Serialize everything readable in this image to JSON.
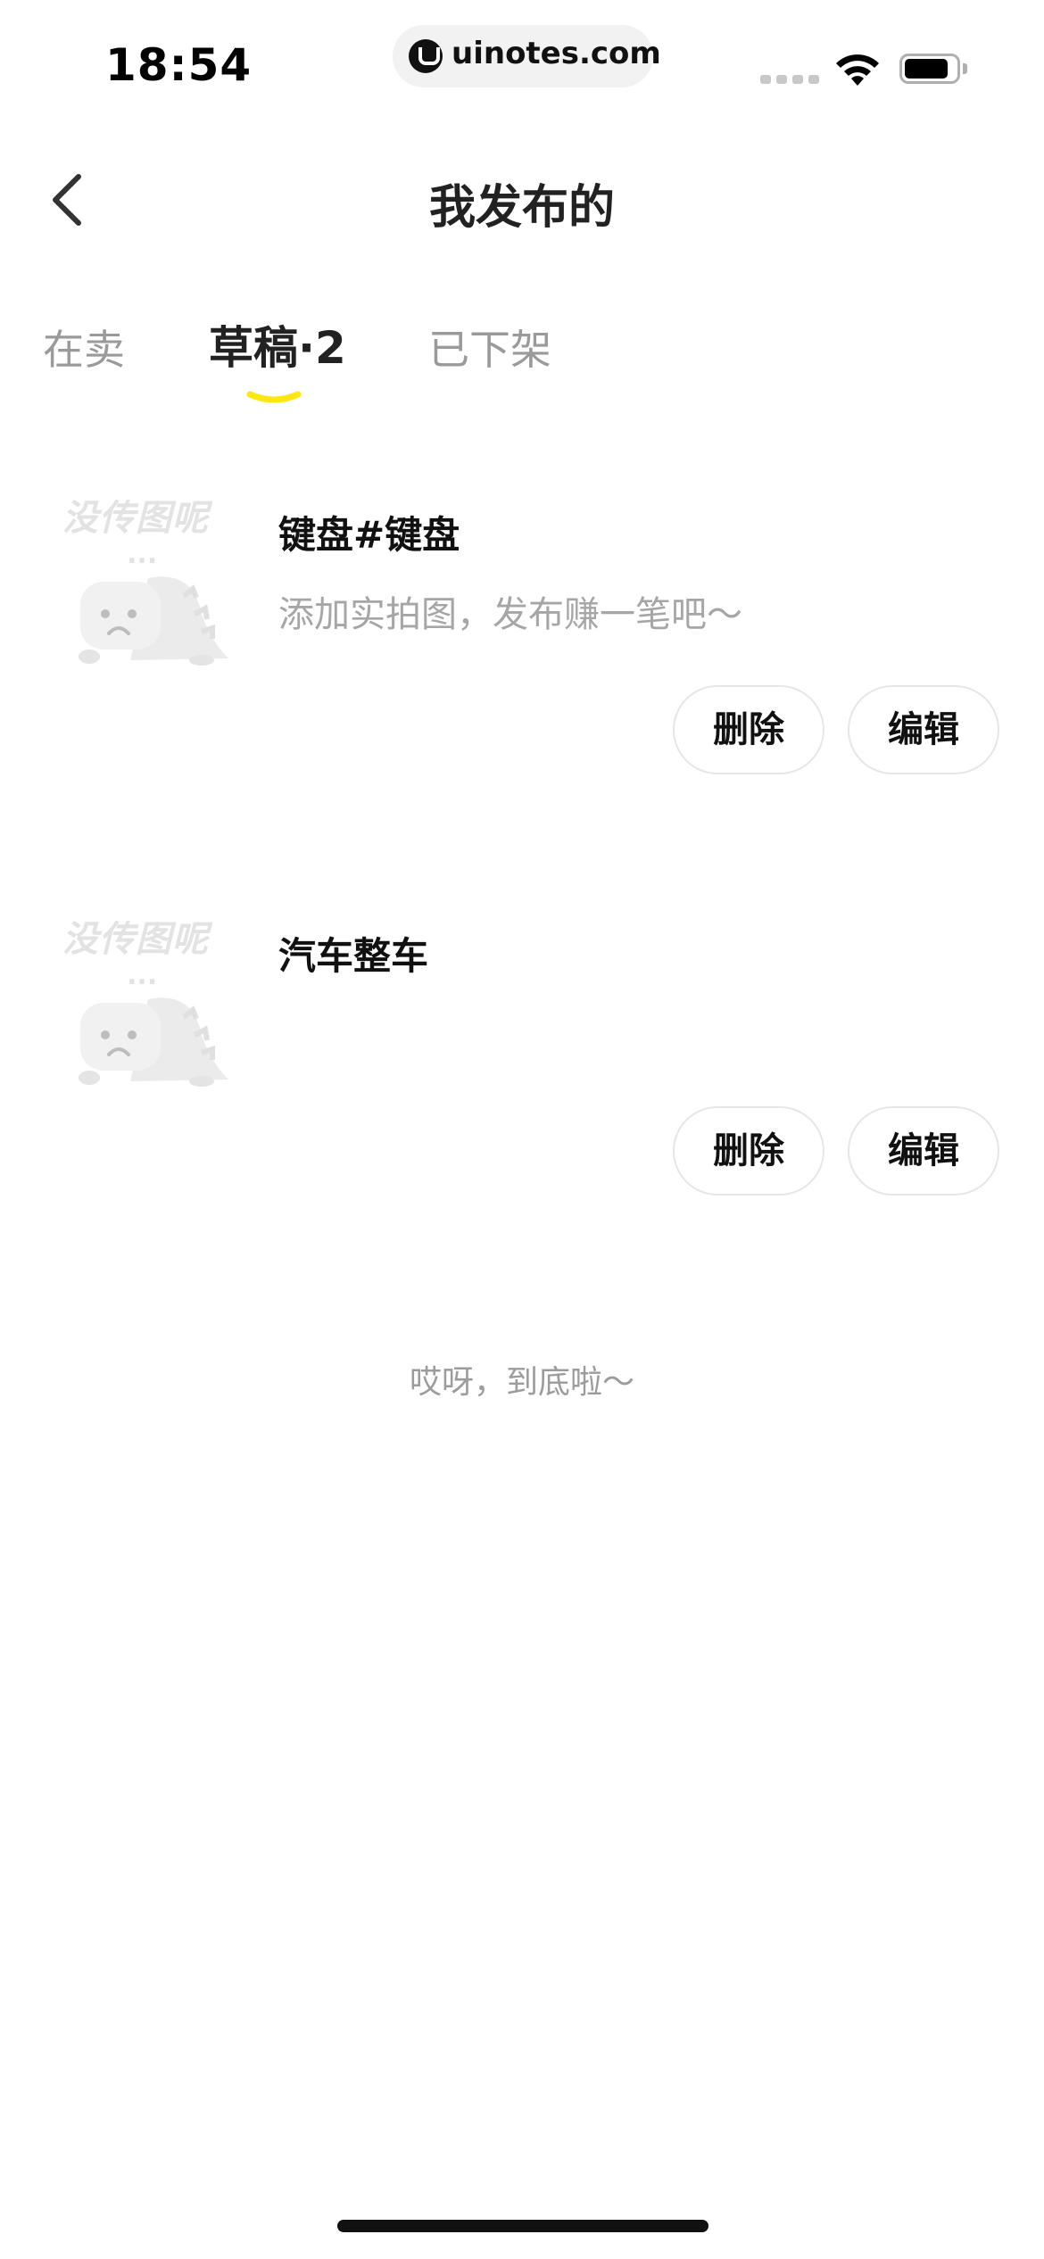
{
  "status_bar": {
    "time": "18:54",
    "url": "uinotes.com"
  },
  "header": {
    "title": "我发布的"
  },
  "tabs": [
    {
      "label": "在卖",
      "active": false
    },
    {
      "label": "草稿·2",
      "active": true
    },
    {
      "label": "已下架",
      "active": false
    }
  ],
  "drafts": [
    {
      "title": "键盘#键盘",
      "subtitle": "添加实拍图，发布赚一笔吧～",
      "placeholder_text": "没传图呢",
      "placeholder_dots": "...",
      "delete_label": "删除",
      "edit_label": "编辑"
    },
    {
      "title": "汽车整车",
      "subtitle": "",
      "placeholder_text": "没传图呢",
      "placeholder_dots": "...",
      "delete_label": "删除",
      "edit_label": "编辑"
    }
  ],
  "list_end_text": "哎呀，到底啦～",
  "colors": {
    "accent": "#FFE60F",
    "muted_text": "#9A9A9A",
    "button_border": "#E6E6E6"
  },
  "icons": [
    "back-arrow-icon",
    "wifi-icon",
    "battery-icon",
    "sad-dinosaur-icon"
  ]
}
